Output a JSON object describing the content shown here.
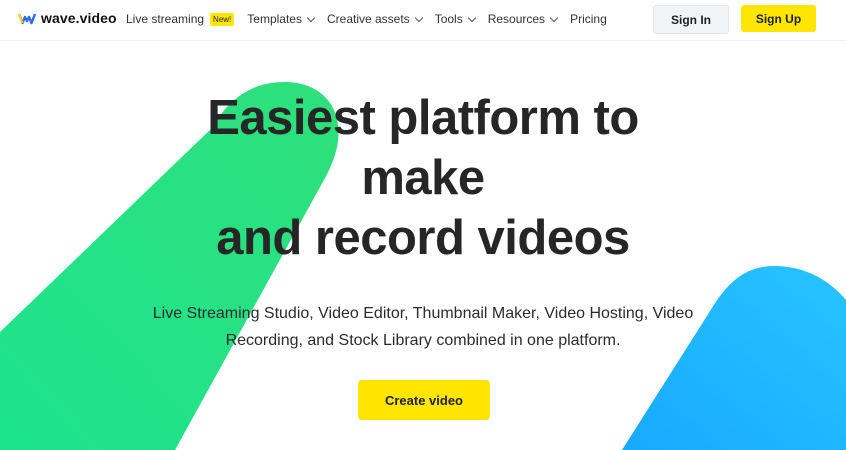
{
  "brand": {
    "name": "wave.video",
    "logo_icon": "wave-logo-icon",
    "accent": "#ffe600"
  },
  "nav": {
    "items": [
      {
        "label": "Live streaming",
        "badge": "New!",
        "has_dropdown": false
      },
      {
        "label": "Templates",
        "has_dropdown": true
      },
      {
        "label": "Creative assets",
        "has_dropdown": true
      },
      {
        "label": "Tools",
        "has_dropdown": true
      },
      {
        "label": "Resources",
        "has_dropdown": true
      },
      {
        "label": "Pricing",
        "has_dropdown": false
      }
    ],
    "sign_in": "Sign In",
    "sign_up": "Sign Up"
  },
  "hero": {
    "headline_lines": [
      "Easiest platform to",
      "make",
      "and record videos"
    ],
    "subtitle": "Live Streaming Studio, Video Editor, Thumbnail Maker, Video Hosting, Video Recording, and Stock Library combined in one platform.",
    "cta": "Create video"
  },
  "colors": {
    "green_shape": "#22e07f",
    "blue_shape": "#1cb6ff"
  }
}
